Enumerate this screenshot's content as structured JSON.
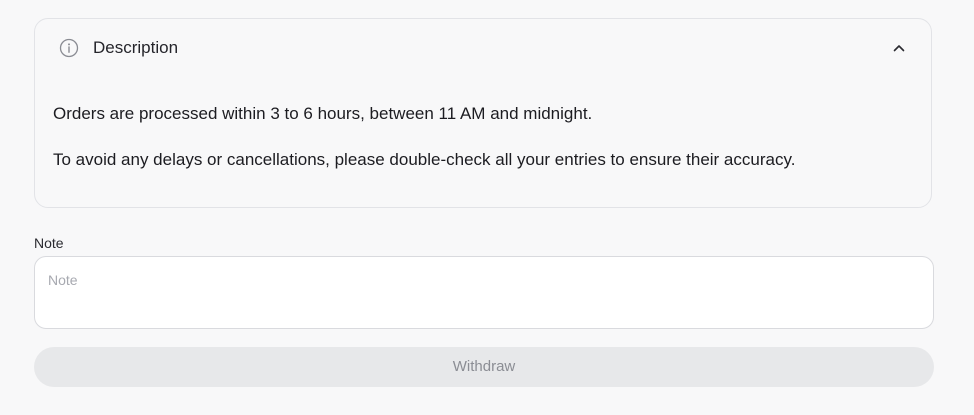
{
  "description": {
    "title": "Description",
    "icon": "info-icon",
    "toggle_icon": "chevron-up-icon",
    "expanded": true,
    "paragraphs": [
      "Orders are processed within 3 to 6 hours, between 11 AM and midnight.",
      "To avoid any delays or cancellations, please double-check all your entries to ensure their accuracy."
    ]
  },
  "note": {
    "label": "Note",
    "placeholder": "Note",
    "value": ""
  },
  "withdraw": {
    "label": "Withdraw",
    "disabled": true
  },
  "colors": {
    "background": "#f8f8f9",
    "border": "#e2e3e7",
    "button_bg_disabled": "#e7e8ea",
    "button_text_disabled": "#8b8d94",
    "placeholder": "#a7a9b0"
  }
}
